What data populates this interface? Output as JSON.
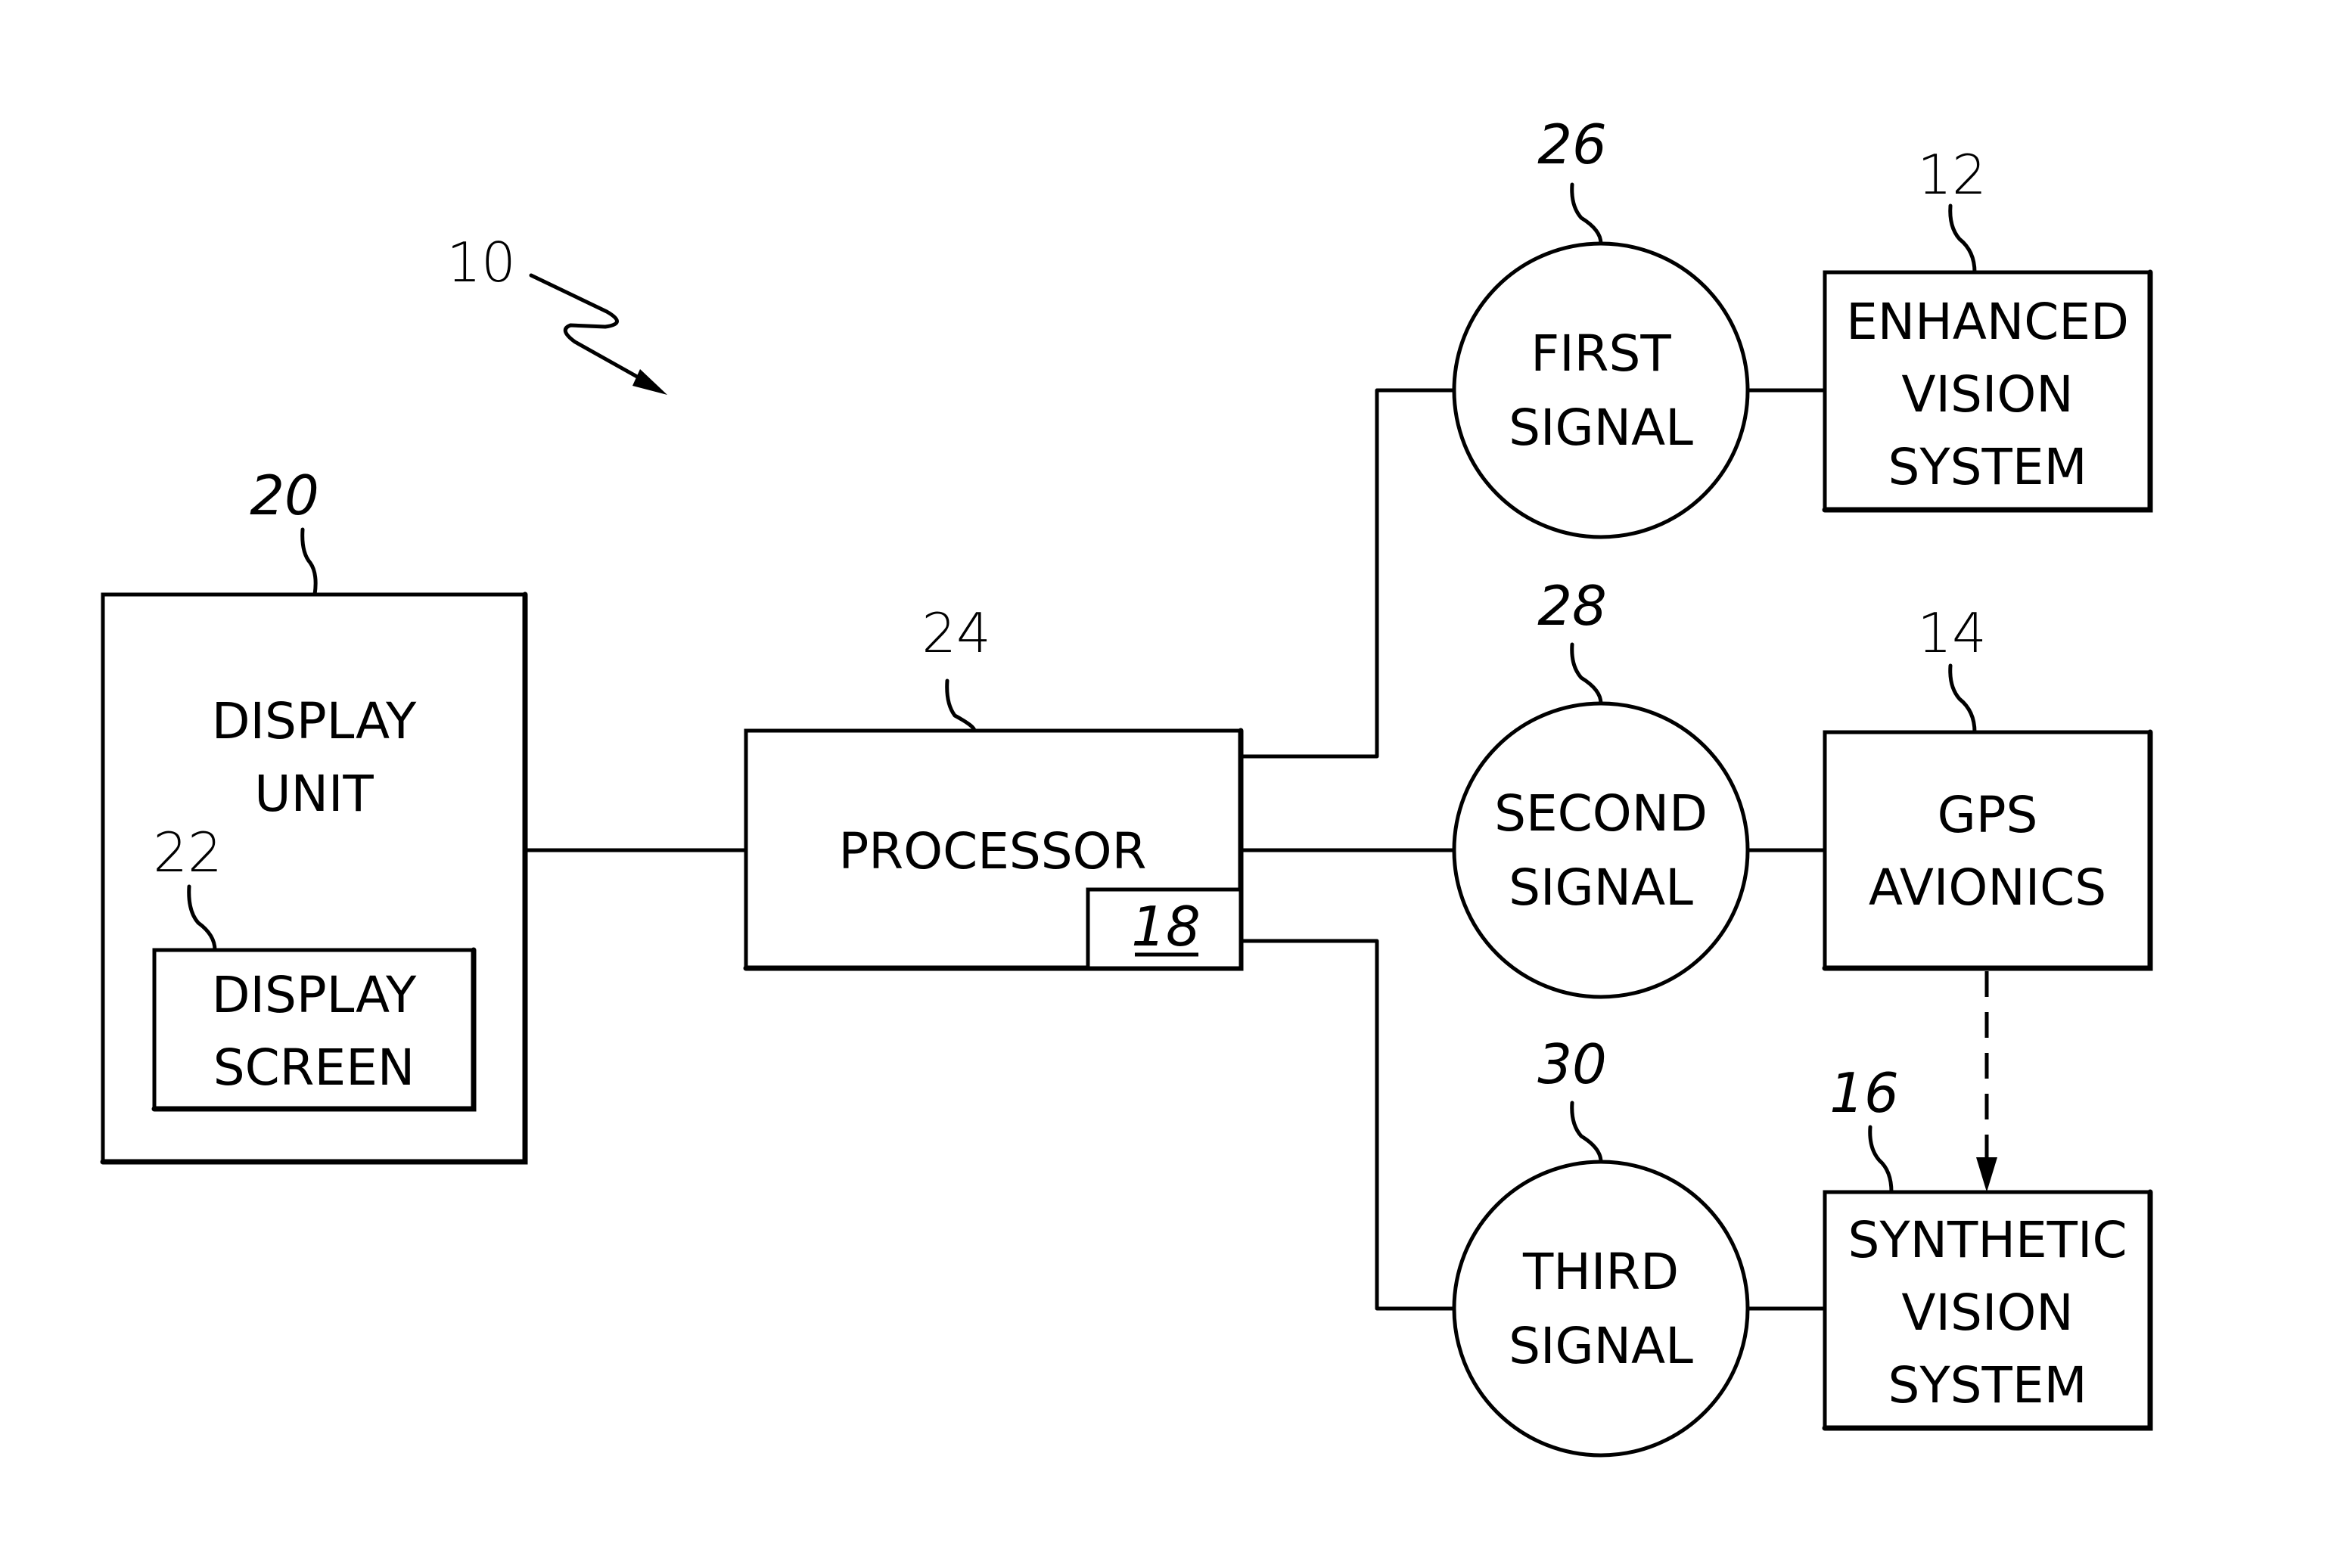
{
  "figure": {
    "system_ref": "10",
    "display_unit": {
      "ref": "20",
      "label_lines": [
        "DISPLAY",
        "UNIT"
      ]
    },
    "display_screen": {
      "ref": "22",
      "label_lines": [
        "DISPLAY",
        "SCREEN"
      ]
    },
    "processor": {
      "ref": "24",
      "label": "PROCESSOR",
      "sub_ref": "18"
    },
    "signals": [
      {
        "ref": "26",
        "label_lines": [
          "FIRST",
          "SIGNAL"
        ]
      },
      {
        "ref": "28",
        "label_lines": [
          "SECOND",
          "SIGNAL"
        ]
      },
      {
        "ref": "30",
        "label_lines": [
          "THIRD",
          "SIGNAL"
        ]
      }
    ],
    "sources": [
      {
        "ref": "12",
        "label_lines": [
          "ENHANCED",
          "VISION",
          "SYSTEM"
        ]
      },
      {
        "ref": "14",
        "label_lines": [
          "GPS",
          "AVIONICS"
        ]
      },
      {
        "ref": "16",
        "label_lines": [
          "SYNTHETIC",
          "VISION",
          "SYSTEM"
        ]
      }
    ],
    "connections": [
      {
        "from": "display-unit",
        "to": "processor",
        "style": "solid"
      },
      {
        "from": "processor",
        "to": "first-signal",
        "style": "solid"
      },
      {
        "from": "processor",
        "to": "second-signal",
        "style": "solid"
      },
      {
        "from": "processor",
        "to": "third-signal",
        "style": "solid"
      },
      {
        "from": "first-signal",
        "to": "enhanced-vision-system",
        "style": "solid"
      },
      {
        "from": "second-signal",
        "to": "gps-avionics",
        "style": "solid"
      },
      {
        "from": "third-signal",
        "to": "synthetic-vision-system",
        "style": "solid"
      },
      {
        "from": "gps-avionics",
        "to": "synthetic-vision-system",
        "style": "dashed-arrow"
      }
    ]
  }
}
